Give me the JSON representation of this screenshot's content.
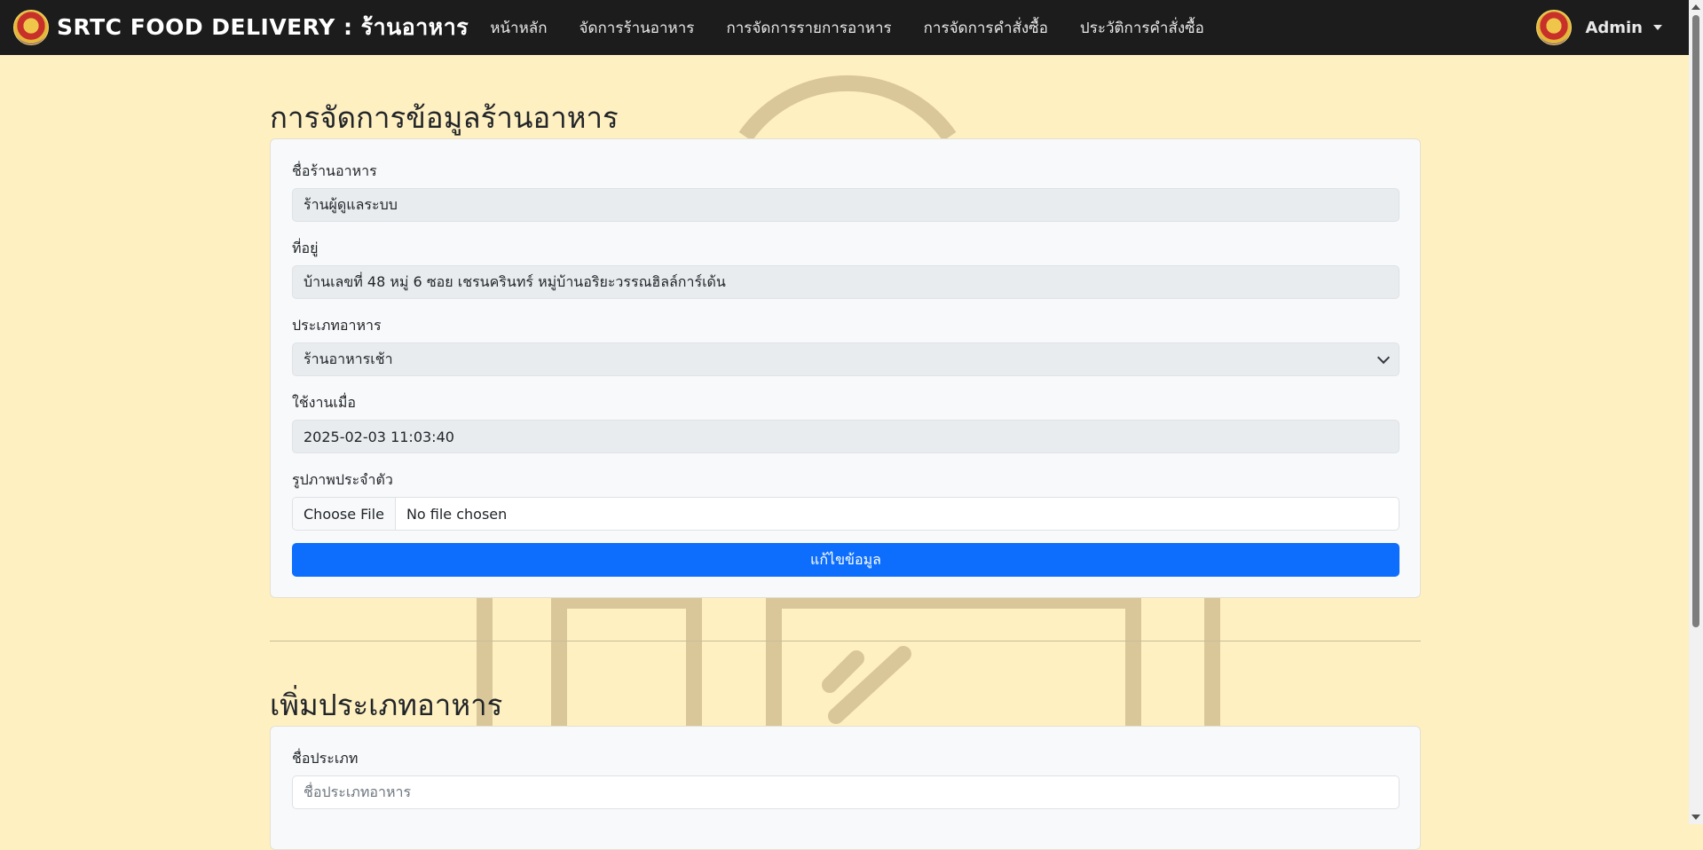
{
  "navbar": {
    "brand": "SRTC FOOD DELIVERY : ร้านอาหาร",
    "links": [
      "หน้าหลัก",
      "จัดการร้านอาหาร",
      "การจัดการรายการอาหาร",
      "การจัดการคำสั่งซื้อ",
      "ประวัติการคำสั่งซื้อ"
    ],
    "user": "Admin"
  },
  "restaurant_section": {
    "title": "การจัดการข้อมูลร้านอาหาร",
    "name_label": "ชื่อร้านอาหาร",
    "name_value": "ร้านผู้ดูแลระบบ",
    "address_label": "ที่อยู่",
    "address_value": "บ้านเลขที่ 48 หมู่ 6 ซอย เชรนครินทร์ หมู่บ้านอริยะวรรณฮิลล์การ์เด้น",
    "type_label": "ประเภทอาหาร",
    "type_value": "ร้านอาหารเช้า",
    "created_label": "ใช้งานเมื่อ",
    "created_value": "2025-02-03 11:03:40",
    "image_label": "รูปภาพประจำตัว",
    "file_button": "Choose File",
    "file_status": "No file chosen",
    "submit_label": "แก้ไขข้อมูล"
  },
  "add_type_section": {
    "title": "เพิ่มประเภทอาหาร",
    "type_name_label": "ชื่อประเภท",
    "type_name_placeholder": "ชื่อประเภทอาหาร"
  },
  "colors": {
    "navbar": "#1c1c1c",
    "background": "#fff0c1",
    "primary": "#0d6efd",
    "watermark": "#d9c79a"
  }
}
